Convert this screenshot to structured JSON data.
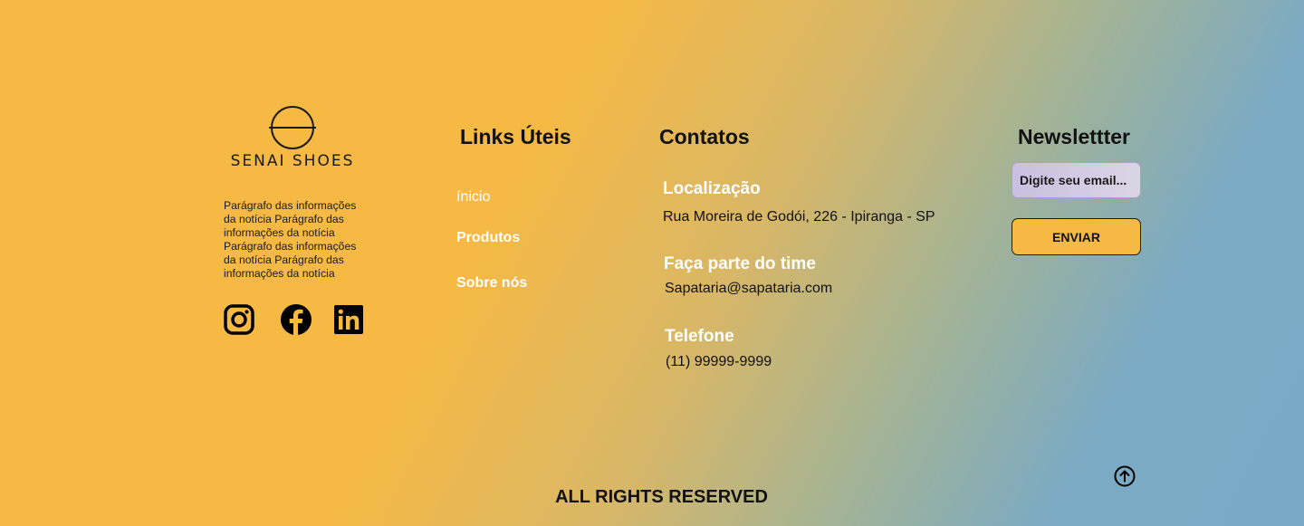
{
  "brand": {
    "name": "SENAI SHOES",
    "logo_icon": "circle-horizon-logo-icon",
    "about": "Parágrafo das informações da notícia Parágrafo das informações da notícia Parágrafo das informações da notícia Parágrafo das informações da notícia"
  },
  "social": [
    {
      "name": "instagram",
      "icon": "instagram-icon"
    },
    {
      "name": "facebook",
      "icon": "facebook-icon"
    },
    {
      "name": "linkedin",
      "icon": "linkedin-icon"
    }
  ],
  "links": {
    "title": "Links Úteis",
    "items": [
      {
        "label": "ínicio"
      },
      {
        "label": "Produtos"
      },
      {
        "label": "Sobre nós"
      }
    ]
  },
  "contacts": {
    "title": "Contatos",
    "location_label": "Localização",
    "location_value": "Rua Moreira de Godói, 226  - Ipiranga - SP",
    "join_label": "Faça parte do time",
    "join_value": "Sapataria@sapataria.com",
    "phone_label": "Telefone",
    "phone_value": "(11) 99999-9999"
  },
  "newsletter": {
    "title": "Newslettter",
    "placeholder": "Digite seu email...",
    "value": "",
    "button": "ENVIAR"
  },
  "footer": {
    "rights": "ALL RIGHTS RESERVED",
    "back_to_top_icon": "arrow-up-circle-icon"
  },
  "colors": {
    "primary": "#f6b944",
    "gradient_end": "#79a9c4",
    "link_text": "#ffffff",
    "dark_text": "#111111"
  }
}
